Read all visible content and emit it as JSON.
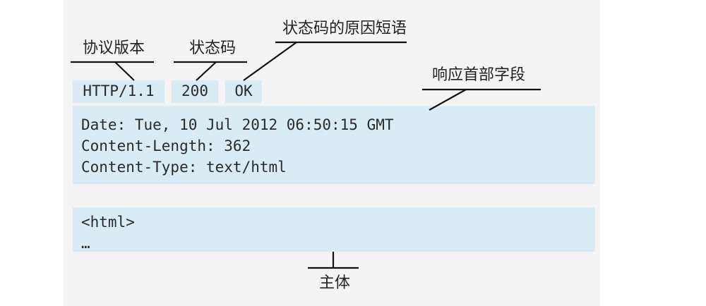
{
  "status_line": {
    "version": "HTTP/1.1",
    "status_code": "200",
    "reason_phrase": "OK"
  },
  "headers": {
    "lines": [
      "Date: Tue, 10 Jul 2012 06:50:15 GMT",
      "Content-Length: 362",
      "Content-Type: text/html"
    ]
  },
  "body": {
    "lines": [
      "<html>",
      "…"
    ]
  },
  "labels": {
    "version": "协议版本",
    "status_code": "状态码",
    "reason_phrase": "状态码的原因短语",
    "headers": "响应首部字段",
    "body": "主体"
  }
}
